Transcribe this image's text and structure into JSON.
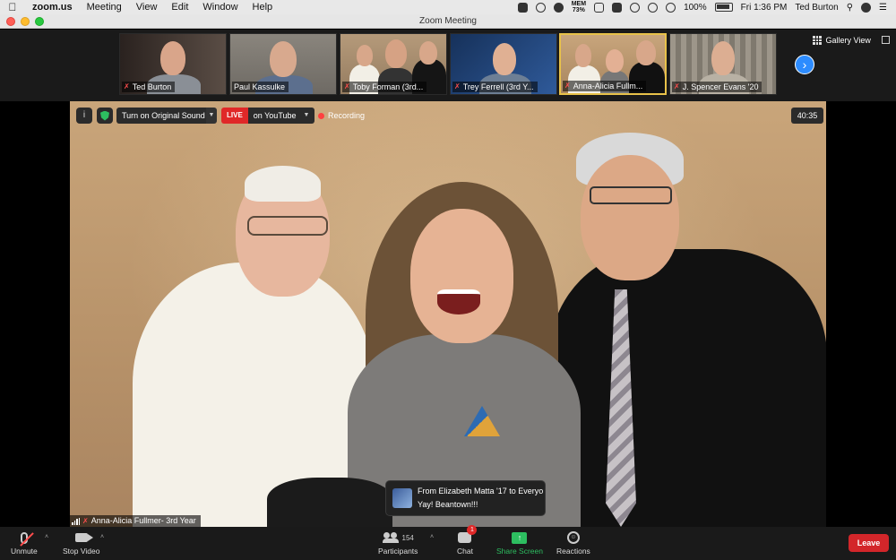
{
  "menubar": {
    "app": "zoom.us",
    "items": [
      "Meeting",
      "View",
      "Edit",
      "Window",
      "Help"
    ],
    "memory_label": "MEM",
    "memory_value": "73%",
    "battery": "100%",
    "time": "Fri 1:36 PM",
    "user": "Ted Burton"
  },
  "window": {
    "title": "Zoom Meeting"
  },
  "gallery": {
    "view_label": "Gallery View",
    "participants": [
      {
        "name": "Ted Burton",
        "bg": "#3b2f2a"
      },
      {
        "name": "Paul Kassulke",
        "bg": "#7a7670"
      },
      {
        "name": "Toby Forman (3rd...",
        "bg": "#a08a6e"
      },
      {
        "name": "Trey Ferrell (3rd Y...",
        "bg": "#20406e"
      },
      {
        "name": "Anna-Alicia Fullm...",
        "bg": "#b79771"
      },
      {
        "name": "J. Spencer Evans '20",
        "bg": "#8e8a7d"
      }
    ]
  },
  "overlay": {
    "sound_label": "Turn on Original Sound",
    "live_tag": "LIVE",
    "live_target": "on YouTube",
    "recording_label": "Recording",
    "timer": "40:35"
  },
  "speaker": {
    "name": "Anna-Alicia Fullmer- 3rd Year"
  },
  "chat_toast": {
    "from": "From Elizabeth Matta '17 to Everyo...",
    "message": "Yay!  Beantown!!!"
  },
  "toolbar": {
    "unmute": "Unmute",
    "stop_video": "Stop Video",
    "participants": "Participants",
    "participant_count": "154",
    "chat": "Chat",
    "chat_badge": "1",
    "share": "Share Screen",
    "reactions": "Reactions",
    "leave": "Leave"
  },
  "colors": {
    "accent_blue": "#2d8cff",
    "active_speaker_border": "#e8c24a",
    "live_red": "#e02828",
    "share_green": "#2dbe60",
    "leave_red": "#d3262a"
  }
}
